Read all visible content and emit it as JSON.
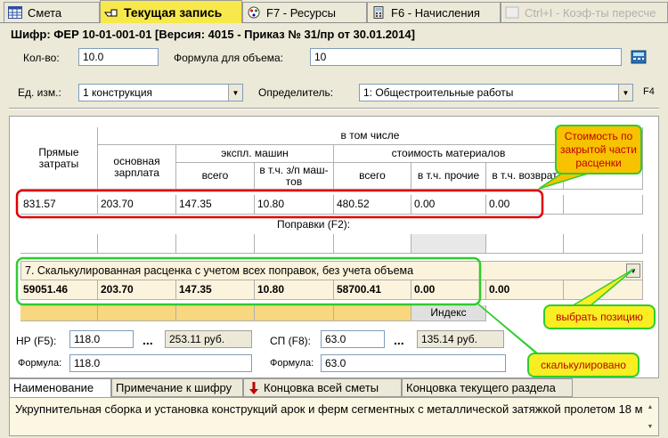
{
  "tabs": [
    {
      "label": "Смета",
      "icon": "table-icon",
      "state": "normal"
    },
    {
      "label": "Текущая запись",
      "icon": "hand-pointer-icon",
      "state": "active"
    },
    {
      "label": "F7 - Ресурсы",
      "icon": "resources-icon",
      "state": "normal"
    },
    {
      "label": "F6 - Начисления",
      "icon": "calculator-icon",
      "state": "normal"
    },
    {
      "label": "Ctrl+I - Коэф-ты пересче",
      "icon": "coef-icon",
      "state": "disabled"
    }
  ],
  "header": {
    "title": "Шифр:  ФЕР 10-01-001-01  [Версия: 4015 - Приказ № 31/пр от 30.01.2014]"
  },
  "form": {
    "qty_label": "Кол-во:",
    "qty_value": "10.0",
    "formula_label": "Формула для объема:",
    "formula_value": "10",
    "unit_label": "Ед. изм.:",
    "unit_value": "1 конструкция",
    "determiner_label": "Определитель:",
    "determiner_value": "1: Общестроительные работы",
    "f4_label": "F4"
  },
  "grid": {
    "col_direct": "Прямые затраты",
    "col_including": "в том числе",
    "col_base_salary": "основная зарплата",
    "col_machines": "экспл. машин",
    "col_materials": "стоимость материалов",
    "col_total": "всего",
    "col_incl_zp": "в т.ч. з/п маш-тов",
    "col_total2": "всего",
    "col_incl_other": "в т.ч. прочие",
    "col_incl_return": "в т.ч. возврат",
    "row1": [
      "831.57",
      "203.70",
      "147.35",
      "10.80",
      "480.52",
      "0.00",
      "0.00"
    ],
    "corrections_label": "Поправки (F2):",
    "calc_select": "7. Скалькулированная расценка с учетом всех поправок, без учета объема",
    "row2": [
      "59051.46",
      "203.70",
      "147.35",
      "10.80",
      "58700.41",
      "0.00",
      "0.00"
    ],
    "index_label": "Индекс"
  },
  "overhead": {
    "nr_label": "НР (F5):",
    "nr_value": "118.0",
    "nr_sum": "253.11 руб.",
    "sp_label": "СП (F8):",
    "sp_value": "63.0",
    "sp_sum": "135.14 руб.",
    "formula_label": "Формула:",
    "nr_formula": "118.0",
    "sp_formula": "63.0",
    "dots": "..."
  },
  "callouts": {
    "cost": "Стоимость по закрытой части расценки",
    "choose": "выбрать позицию",
    "calculated": "скалькулировано"
  },
  "bottom_tabs": [
    "Наименование",
    "Примечание к шифру",
    "Концовка всей сметы",
    "Концовка текущего раздела"
  ],
  "description": "Укрупнительная сборка и установка конструкций арок и ферм сегментных с металлической затяжкой пролетом 18 м",
  "colors": {
    "accent_red": "#e00000",
    "accent_green": "#2ecc2e",
    "tab_active": "#f7e94b"
  }
}
